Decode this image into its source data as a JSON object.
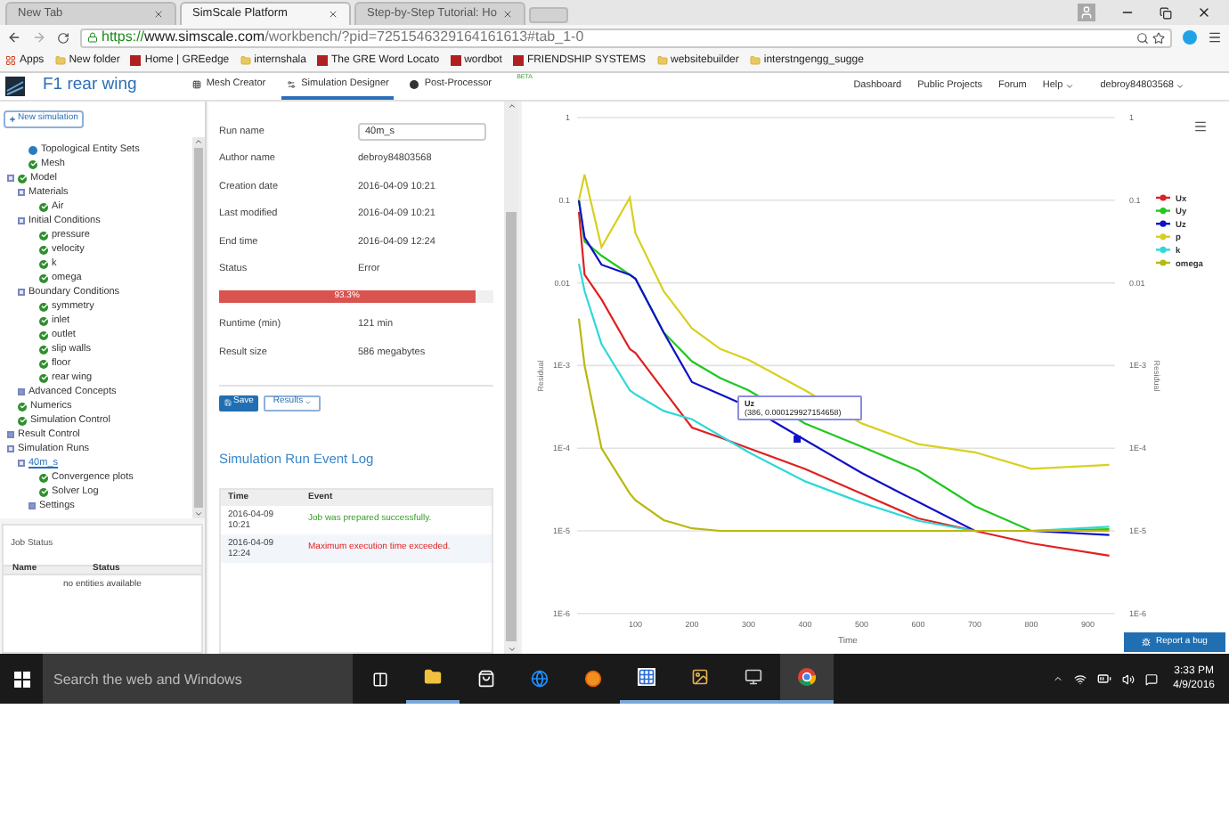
{
  "browser": {
    "tabs": [
      {
        "title": "New Tab",
        "selected": false
      },
      {
        "title": "SimScale Platform",
        "selected": true
      },
      {
        "title": "Step-by-Step Tutorial: Ho",
        "selected": false
      }
    ],
    "url": {
      "scheme": "https://",
      "host": "www.simscale.com",
      "path": "/workbench/?pid=7251546329164161613#tab_1-0"
    },
    "bookmarks": [
      {
        "label": "Apps",
        "kind": "apps"
      },
      {
        "label": "New folder",
        "kind": "folder"
      },
      {
        "label": "Home | GREedge",
        "kind": "site"
      },
      {
        "label": "internshala",
        "kind": "folder"
      },
      {
        "label": "The GRE Word Locato",
        "kind": "site"
      },
      {
        "label": "wordbot",
        "kind": "site"
      },
      {
        "label": "FRIENDSHIP SYSTEMS",
        "kind": "site"
      },
      {
        "label": "websitebuilder",
        "kind": "folder"
      },
      {
        "label": "interstngengg_sugge",
        "kind": "folder"
      }
    ]
  },
  "app": {
    "project": "F1 rear wing",
    "nav": [
      {
        "label": "Mesh Creator",
        "kind": "mesh",
        "selected": false
      },
      {
        "label": "Simulation Designer",
        "kind": "designer",
        "selected": true
      },
      {
        "label": "Post-Processor",
        "kind": "post",
        "selected": false,
        "badge": "BETA"
      }
    ],
    "links": [
      {
        "label": "Dashboard"
      },
      {
        "label": "Public Projects"
      },
      {
        "label": "Forum"
      },
      {
        "label": "Help",
        "menu": true
      }
    ],
    "user": "debroy84803568"
  },
  "sidebar": {
    "new_button": "New simulation",
    "tree": [
      {
        "label": "Topological Entity Sets",
        "kind": "dot"
      },
      {
        "label": "Mesh",
        "checked": true
      },
      {
        "label": "Model",
        "checked": true,
        "expanded": true,
        "children": [
          {
            "label": "Materials",
            "expanded": true,
            "children": [
              {
                "label": "Air",
                "checked": true
              }
            ]
          },
          {
            "label": "Initial Conditions",
            "expanded": true,
            "children": [
              {
                "label": "pressure",
                "checked": true
              },
              {
                "label": "velocity",
                "checked": true
              },
              {
                "label": "k",
                "checked": true
              },
              {
                "label": "omega",
                "checked": true
              }
            ]
          },
          {
            "label": "Boundary Conditions",
            "expanded": true,
            "children": [
              {
                "label": "symmetry",
                "checked": true
              },
              {
                "label": "inlet",
                "checked": true
              },
              {
                "label": "outlet",
                "checked": true
              },
              {
                "label": "slip walls",
                "checked": true
              },
              {
                "label": "floor",
                "checked": true
              },
              {
                "label": "rear wing",
                "checked": true
              }
            ]
          },
          {
            "label": "Advanced Concepts",
            "expanded": false
          }
        ]
      },
      {
        "label": "Numerics",
        "checked": true
      },
      {
        "label": "Simulation Control",
        "checked": true
      },
      {
        "label": "Result Control",
        "expanded": false
      },
      {
        "label": "Simulation Runs",
        "expanded": true,
        "children": [
          {
            "label": "40m_s",
            "kind": "link",
            "expanded": true,
            "children": [
              {
                "label": "Convergence plots",
                "checked": true
              },
              {
                "label": "Solver Log",
                "checked": true
              },
              {
                "label": "Settings",
                "expanded": false
              }
            ]
          }
        ]
      }
    ],
    "job_status": {
      "title": "Job Status",
      "columns": [
        "Name",
        "Status"
      ],
      "empty": "no entities available"
    }
  },
  "run": {
    "fields": [
      {
        "kind": "input",
        "label": "Run name",
        "value": "40m_s"
      },
      {
        "kind": "text",
        "label": "Author name",
        "value": "debroy84803568"
      },
      {
        "kind": "text",
        "label": "Creation date",
        "value": "2016-04-09 10:21"
      },
      {
        "kind": "text",
        "label": "Last modified",
        "value": "2016-04-09 10:21"
      },
      {
        "kind": "text",
        "label": "End time",
        "value": "2016-04-09 12:24"
      },
      {
        "kind": "text",
        "label": "Status",
        "value": "Error"
      },
      {
        "kind": "progress",
        "level": 0.933,
        "reading": "93.3%"
      },
      {
        "kind": "text",
        "label": "Runtime (min)",
        "value": "121 min"
      },
      {
        "kind": "text",
        "label": "Result size",
        "value": "586 megabytes"
      }
    ],
    "buttons": [
      {
        "label": "Save",
        "kind": "primary"
      },
      {
        "label": "Results",
        "kind": "dropdown"
      }
    ],
    "event_log": {
      "title": "Simulation Run Event Log",
      "columns": [
        "Time",
        "Event"
      ],
      "rows": [
        {
          "time": "2016-04-09 10:21",
          "event": "Job was prepared successfully.",
          "kind": "success"
        },
        {
          "time": "2016-04-09 12:24",
          "event": "Maximum execution time exceeded.",
          "kind": "error"
        }
      ]
    }
  },
  "chart": {
    "xlabel": "Time",
    "ylabel": "Residual",
    "x_ticks": [
      "100",
      "200",
      "300",
      "400",
      "500",
      "600",
      "700",
      "800",
      "900"
    ],
    "y_ticks": [
      "1",
      "0.1",
      "0.01",
      "1E-3",
      "1E-4",
      "1E-5",
      "1E-6"
    ],
    "legend": [
      {
        "name": "Ux",
        "color": "#e02020"
      },
      {
        "name": "Uy",
        "color": "#20c820"
      },
      {
        "name": "Uz",
        "color": "#1010c8"
      },
      {
        "name": "p",
        "color": "#d8d020"
      },
      {
        "name": "k",
        "color": "#30d8d8"
      },
      {
        "name": "omega",
        "color": "#b8b810"
      }
    ],
    "tooltip": [
      "Uz",
      "(386, 0.000129927154658)"
    ],
    "right_axis": {
      "title": "Residual",
      "ticks": [
        "1",
        "0.1",
        "0.01",
        "1E-3",
        "1E-4",
        "1E-5",
        "1E-6"
      ]
    },
    "report_button": "Report a bug"
  },
  "taskbar": {
    "search": {
      "placeholder": "Search the web and Windows"
    },
    "clock": {
      "time": "3:33 PM",
      "date": "4/9/2016"
    }
  }
}
